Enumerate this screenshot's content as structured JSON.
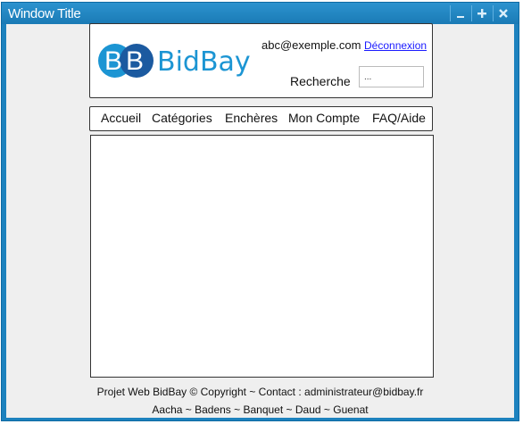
{
  "window": {
    "title": "Window Title",
    "minimize_icon": "minimize-icon",
    "maximize_icon": "plus-icon",
    "close_icon": "close-icon"
  },
  "header": {
    "logo": {
      "letters": "BB",
      "wordmark": "BidBay"
    },
    "user_email": "abc@exemple.com",
    "logout_link": "Déconnexion",
    "search": {
      "label": "Recherche",
      "value": "..."
    }
  },
  "nav": {
    "items": [
      {
        "label": "Accueil"
      },
      {
        "label": "Catégories"
      },
      {
        "label": "Enchères"
      },
      {
        "label": "Mon Compte"
      },
      {
        "label": "FAQ/Aide"
      }
    ]
  },
  "footer": {
    "line1": "Projet Web BidBay © Copyright ~ Contact : administrateur@bidbay.fr",
    "line2": "Aacha ~ Badens ~ Banquet ~ Daud ~ Guenat"
  },
  "colors": {
    "titlebar": "#1d82be",
    "logo_blue": "#1c95d3",
    "logo_dark": "#1b5aa0",
    "link": "#1a1aff"
  }
}
